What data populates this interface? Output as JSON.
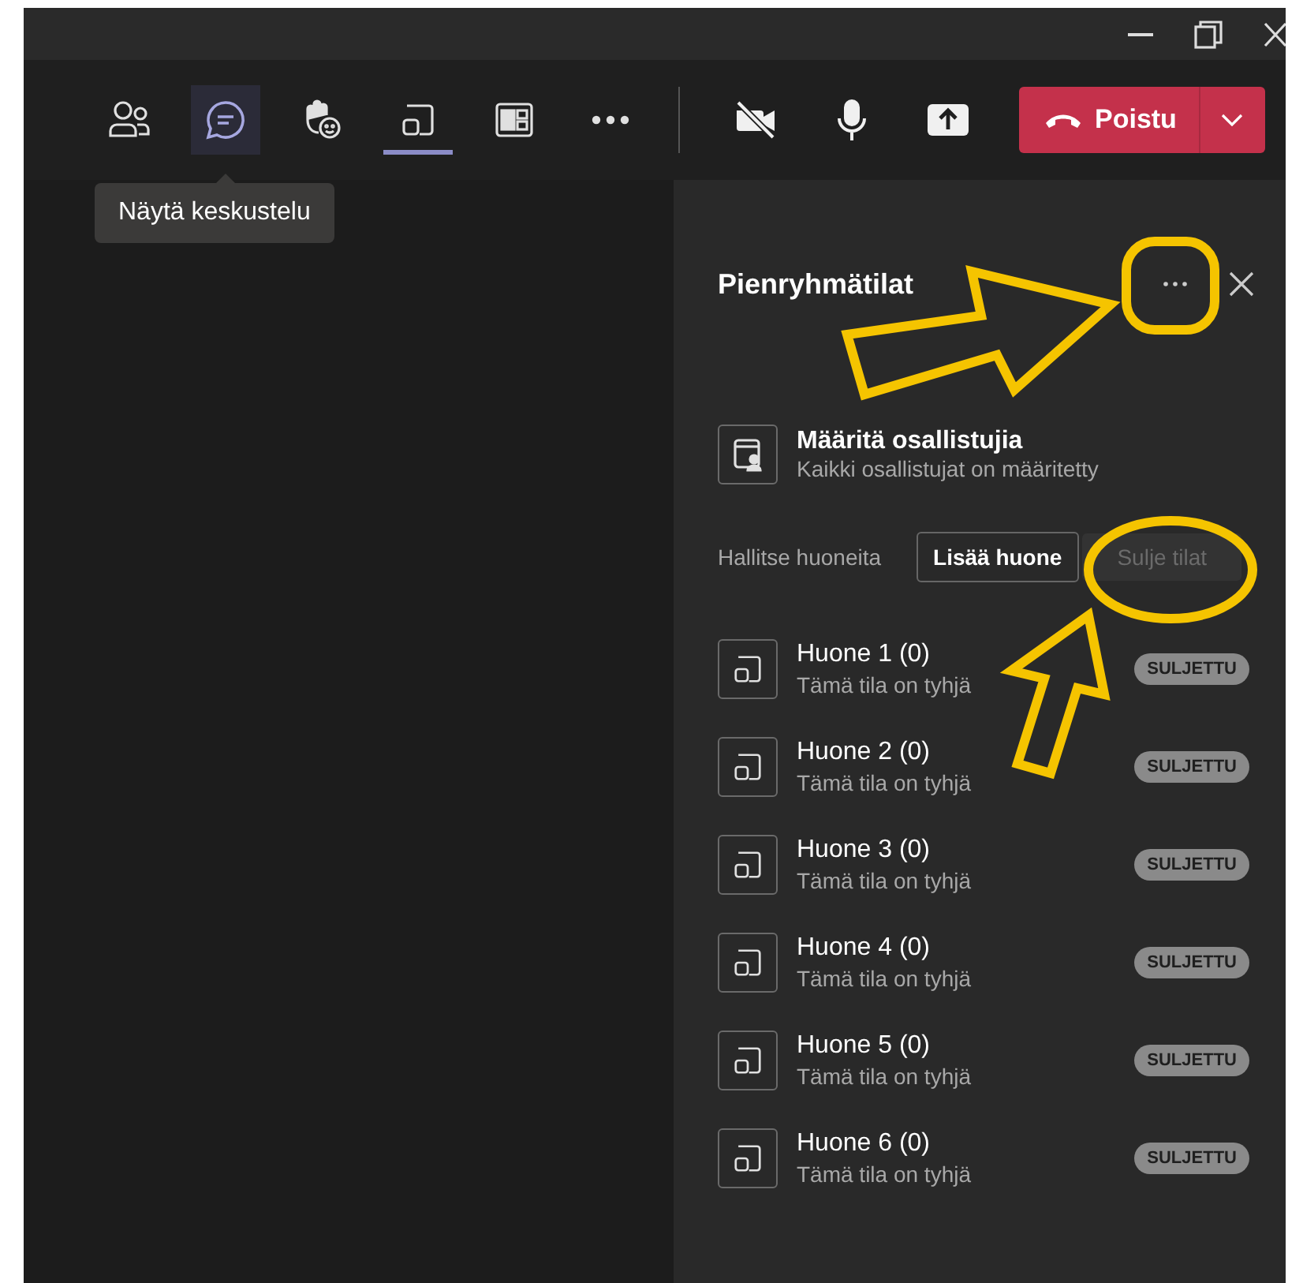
{
  "toolbar": {
    "buttons": [
      {
        "kind": "people",
        "selected": false,
        "hovered": false
      },
      {
        "kind": "chat",
        "selected": false,
        "hovered": true
      },
      {
        "kind": "react",
        "selected": false,
        "hovered": false
      },
      {
        "kind": "rooms",
        "selected": true,
        "hovered": false
      },
      {
        "kind": "apps",
        "selected": false,
        "hovered": false
      },
      {
        "kind": "more",
        "selected": false,
        "hovered": false
      }
    ],
    "call_controls": [
      {
        "kind": "camera_off"
      },
      {
        "kind": "mic"
      },
      {
        "kind": "share"
      }
    ],
    "leave_button": {
      "label": "Poistu"
    }
  },
  "tooltip": "Näytä keskustelu",
  "panel": {
    "title": "Pienryhmätilat",
    "assign": {
      "title": "Määritä osallistujia",
      "subtitle": "Kaikki osallistujat on määritetty"
    },
    "manage_label": "Hallitse huoneita",
    "buttons": [
      {
        "label": "Lisää huone",
        "disabled": false
      },
      {
        "label": "Sulje tilat",
        "disabled": true
      }
    ],
    "rooms": [
      {
        "name": "Huone 1 (0)",
        "status": "Tämä tila on tyhjä",
        "badge": "SULJETTU"
      },
      {
        "name": "Huone 2 (0)",
        "status": "Tämä tila on tyhjä",
        "badge": "SULJETTU"
      },
      {
        "name": "Huone 3 (0)",
        "status": "Tämä tila on tyhjä",
        "badge": "SULJETTU"
      },
      {
        "name": "Huone 4 (0)",
        "status": "Tämä tila on tyhjä",
        "badge": "SULJETTU"
      },
      {
        "name": "Huone 5 (0)",
        "status": "Tämä tila on tyhjä",
        "badge": "SULJETTU"
      },
      {
        "name": "Huone 6 (0)",
        "status": "Tämä tila on tyhjä",
        "badge": "SULJETTU"
      }
    ]
  }
}
